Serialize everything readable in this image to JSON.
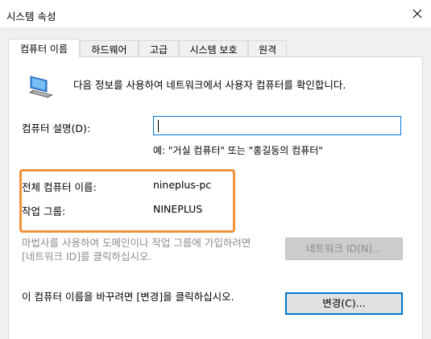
{
  "window": {
    "title": "시스템 속성"
  },
  "tabs": [
    {
      "label": "컴퓨터 이름",
      "active": true
    },
    {
      "label": "하드웨어",
      "active": false
    },
    {
      "label": "고급",
      "active": false
    },
    {
      "label": "시스템 보호",
      "active": false
    },
    {
      "label": "원격",
      "active": false
    }
  ],
  "panel": {
    "info_text": "다음 정보를 사용하여 네트워크에서 사용자 컴퓨터를 확인합니다.",
    "description_label": "컴퓨터 설명(D):",
    "description_value": "",
    "description_example": "예: \"거실 컴퓨터\" 또는 \"홍길동의 컴퓨터\"",
    "full_name_label": "전체 컴퓨터 이름:",
    "full_name_value": "nineplus-pc",
    "workgroup_label": "작업 그룹:",
    "workgroup_value": "NINEPLUS",
    "wizard_text": "마법사를 사용하여 도메인이나 작업 그룹에 가입하려면 [네트워크 ID]를 클릭하십시오.",
    "network_id_button": "네트워크 ID(N)...",
    "rename_text": "이 컴퓨터 이름을 바꾸려면 [변경]을 클릭하십시오.",
    "change_button": "변경(C)..."
  },
  "colors": {
    "highlight": "#f0923a",
    "focus_border": "#0078d7",
    "disabled_text": "#8c8c8c"
  },
  "icons": [
    "computer-icon",
    "close-icon"
  ]
}
